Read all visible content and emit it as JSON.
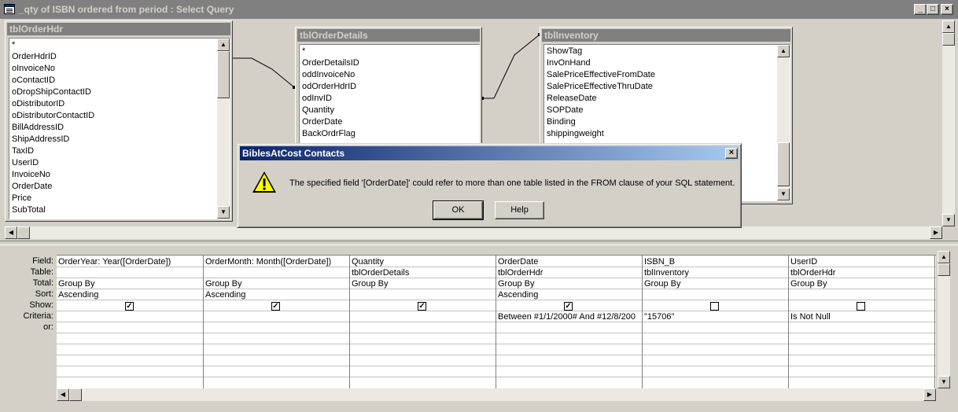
{
  "window": {
    "title": "_qty of ISBN ordered from period : Select Query",
    "min_label": "_",
    "max_label": "□",
    "close_label": "×"
  },
  "tables": [
    {
      "name": "tblOrderHdr",
      "fields": [
        "*",
        "OrderHdrID",
        "oInvoiceNo",
        "oContactID",
        "oDropShipContactID",
        "oDistributorID",
        "oDistributorContactID",
        "BillAddressID",
        "ShipAddressID",
        "TaxID",
        "UserID",
        "InvoiceNo",
        "OrderDate",
        "Price",
        "SubTotal"
      ]
    },
    {
      "name": "tblOrderDetails",
      "fields": [
        "*",
        "OrderDetailsID",
        "oddInvoiceNo",
        "odOrderHdrID",
        "odInvID",
        "Quantity",
        "OrderDate",
        "BackOrdrFlag"
      ]
    },
    {
      "name": "tblInventory",
      "fields": [
        "ShowTag",
        "InvOnHand",
        "SalePriceEffectiveFromDate",
        "SalePriceEffectiveThruDate",
        "ReleaseDate",
        "SOPDate",
        "Binding",
        "shippingweight"
      ]
    }
  ],
  "dialog": {
    "title": "BiblesAtCost Contacts",
    "close_label": "×",
    "message": "The specified field '[OrderDate]' could refer to more than one table listed in the FROM clause of your SQL statement.",
    "ok_label": "OK",
    "help_label": "Help",
    "icon": "warning-icon"
  },
  "grid": {
    "row_labels": [
      "Field:",
      "Table:",
      "Total:",
      "Sort:",
      "Show:",
      "Criteria:",
      "or:"
    ],
    "columns": [
      {
        "field": "OrderYear: Year([OrderDate])",
        "table": "",
        "total": "Group By",
        "sort": "Ascending",
        "show": true,
        "criteria": "",
        "or": ""
      },
      {
        "field": "OrderMonth: Month([OrderDate])",
        "table": "",
        "total": "Group By",
        "sort": "Ascending",
        "show": true,
        "criteria": "",
        "or": ""
      },
      {
        "field": "Quantity",
        "table": "tblOrderDetails",
        "total": "Group By",
        "sort": "",
        "show": true,
        "criteria": "",
        "or": ""
      },
      {
        "field": "OrderDate",
        "table": "tblOrderHdr",
        "total": "Group By",
        "sort": "Ascending",
        "show": true,
        "criteria": "Between #1/1/2000# And #12/8/200",
        "or": ""
      },
      {
        "field": "ISBN_B",
        "table": "tblInventory",
        "total": "Group By",
        "sort": "",
        "show": false,
        "criteria": "\"15706\"",
        "or": ""
      },
      {
        "field": "UserID",
        "table": "tblOrderHdr",
        "total": "Group By",
        "sort": "",
        "show": false,
        "criteria": "Is Not Null",
        "or": ""
      }
    ]
  }
}
